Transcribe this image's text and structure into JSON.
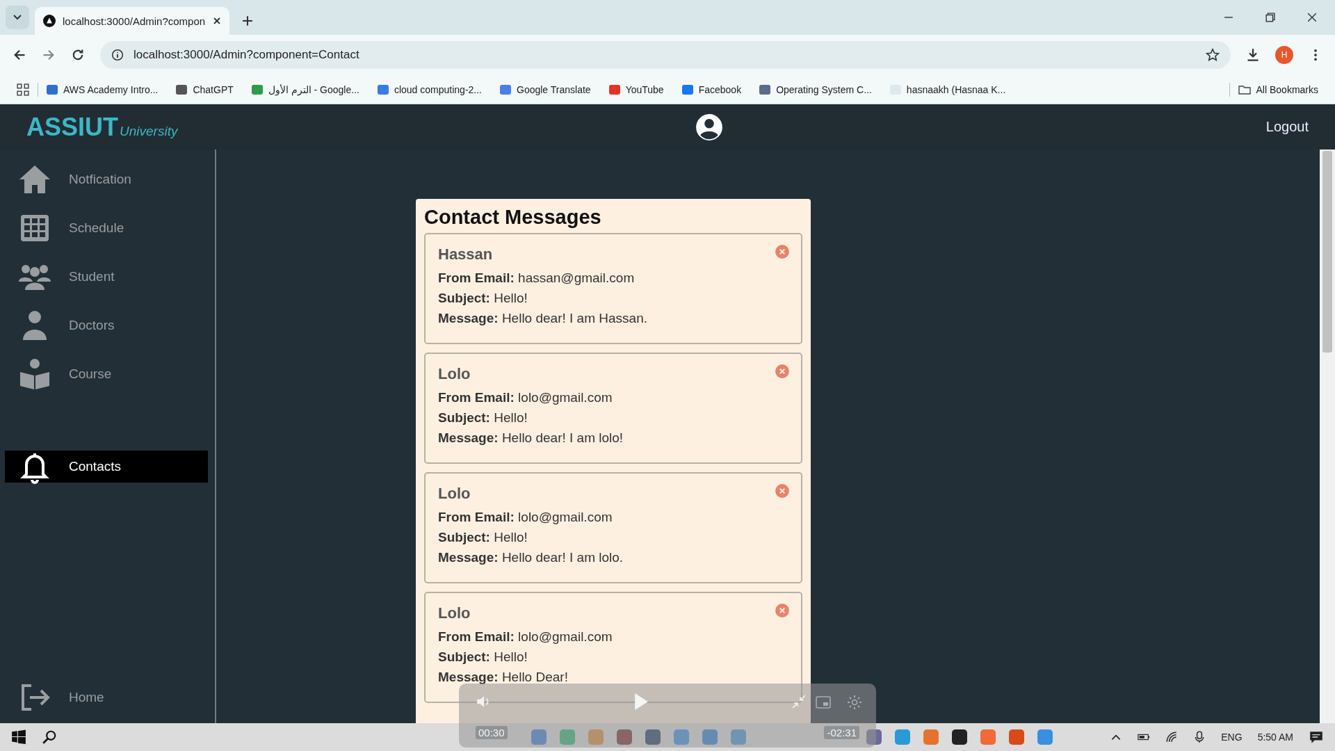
{
  "browser": {
    "tab_title": "localhost:3000/Admin?compon",
    "url": "localhost:3000/Admin?component=Contact",
    "bookmarks": [
      {
        "label": "AWS Academy Intro...",
        "color": "#2f6fd0"
      },
      {
        "label": "ChatGPT",
        "color": "#555555"
      },
      {
        "label": "الترم الأول - Google...",
        "color": "#2a9d4a"
      },
      {
        "label": "cloud computing-2...",
        "color": "#3a7be0"
      },
      {
        "label": "Google Translate",
        "color": "#4a7fe8"
      },
      {
        "label": "YouTube",
        "color": "#e53323"
      },
      {
        "label": "Facebook",
        "color": "#1877f2"
      },
      {
        "label": "Operating System C...",
        "color": "#5a6b8c"
      },
      {
        "label": "hasnaakh (Hasnaa K...",
        "color": "#dfe9ec"
      }
    ],
    "all_bookmarks": "All Bookmarks",
    "profile_initial": "H"
  },
  "app": {
    "logo_main": "ASSIUT",
    "logo_sub": "University",
    "logout": "Logout"
  },
  "sidebar": {
    "items": [
      {
        "label": "Notfication",
        "selected": false
      },
      {
        "label": "Schedule",
        "selected": false
      },
      {
        "label": "Student",
        "selected": false
      },
      {
        "label": "Doctors",
        "selected": false
      },
      {
        "label": "Course",
        "selected": false
      }
    ],
    "secondary_items": [
      {
        "label": "Contacts",
        "selected": true
      }
    ],
    "footer_item": {
      "label": "Home"
    }
  },
  "contacts": {
    "title": "Contact Messages",
    "messages": [
      {
        "name": "Hassan",
        "lines": [
          "**From Email:** hassan@gmail.com",
          "**Subject:** Hello!",
          "**Message:** Hello dear! I am Hassan."
        ]
      },
      {
        "name": "Lolo",
        "lines": [
          "**From Email:** lolo@gmail.com",
          "**Subject:** Hello!",
          "**Message:** Hello dear! I am lolo!"
        ]
      },
      {
        "name": "Lolo",
        "lines": [
          "**From Email:** lolo@gmail.com",
          "**Subject:** Hello!",
          "**Message:** Hello dear! I am lolo."
        ]
      },
      {
        "name": "Lolo",
        "lines": [
          "**From Email:** lolo@gmail.com",
          "**Subject:** Hello!",
          "**Message:** Hello Dear!"
        ]
      }
    ]
  },
  "video_player": {
    "elapsed": "00:30",
    "remaining": "-02:31"
  },
  "taskbar": {
    "language": "ENG",
    "time": "5:50 AM"
  }
}
